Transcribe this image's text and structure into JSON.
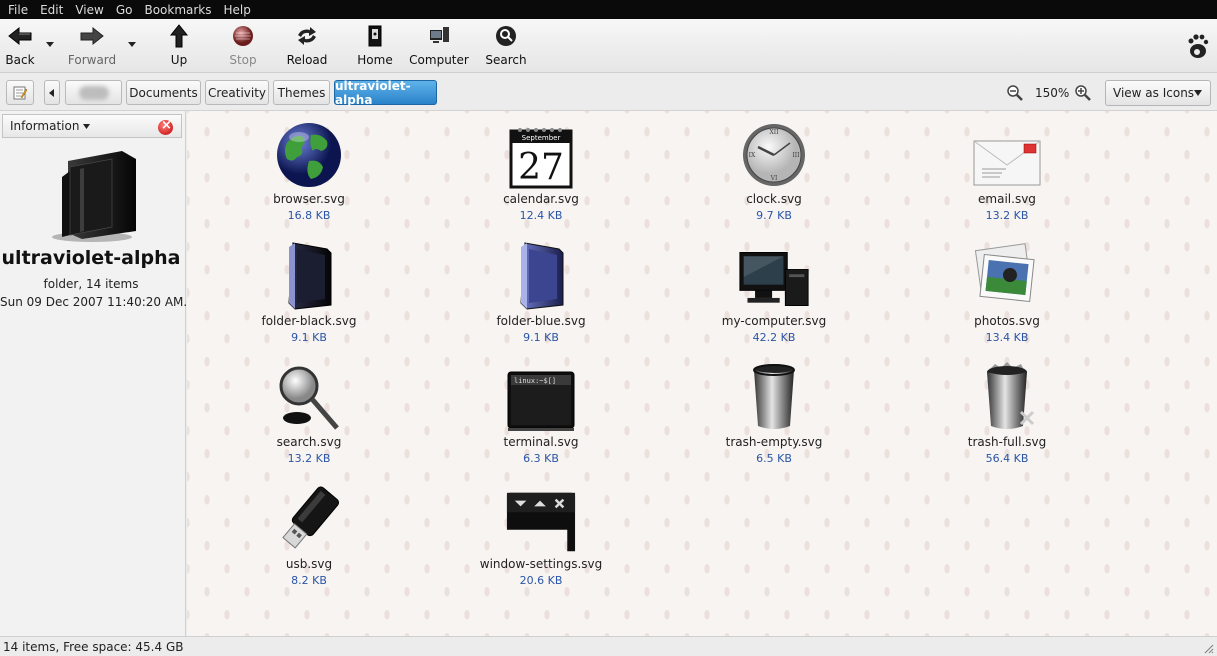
{
  "menubar": {
    "items": [
      "File",
      "Edit",
      "View",
      "Go",
      "Bookmarks",
      "Help"
    ]
  },
  "toolbar": {
    "back": "Back",
    "forward": "Forward",
    "up": "Up",
    "stop": "Stop",
    "reload": "Reload",
    "home": "Home",
    "computer": "Computer",
    "search": "Search"
  },
  "location": {
    "crumbs": [
      "Documents",
      "Creativity",
      "Themes",
      "ultraviolet-alpha"
    ],
    "zoom": "150%",
    "view_mode": "View as Icons"
  },
  "sidebar": {
    "header": "Information",
    "folder_name": "ultraviolet-alpha",
    "folder_info": "folder, 14 items",
    "modified": "Sun 09 Dec 2007 11:40:20 AM..."
  },
  "files": [
    {
      "name": "browser.svg",
      "size": "16.8 KB",
      "icon": "globe-icon"
    },
    {
      "name": "calendar.svg",
      "size": "12.4 KB",
      "icon": "calendar-icon"
    },
    {
      "name": "clock.svg",
      "size": "9.7 KB",
      "icon": "clock-icon"
    },
    {
      "name": "email.svg",
      "size": "13.2 KB",
      "icon": "envelope-icon"
    },
    {
      "name": "folder-black.svg",
      "size": "9.1 KB",
      "icon": "black-folder-icon"
    },
    {
      "name": "folder-blue.svg",
      "size": "9.1 KB",
      "icon": "blue-folder-icon"
    },
    {
      "name": "my-computer.svg",
      "size": "42.2 KB",
      "icon": "computer-icon"
    },
    {
      "name": "photos.svg",
      "size": "13.4 KB",
      "icon": "photos-icon"
    },
    {
      "name": "search.svg",
      "size": "13.2 KB",
      "icon": "magnifier-icon"
    },
    {
      "name": "terminal.svg",
      "size": "6.3 KB",
      "icon": "terminal-icon"
    },
    {
      "name": "trash-empty.svg",
      "size": "6.5 KB",
      "icon": "trash-empty-icon"
    },
    {
      "name": "trash-full.svg",
      "size": "56.4 KB",
      "icon": "trash-full-icon"
    },
    {
      "name": "usb.svg",
      "size": "8.2 KB",
      "icon": "usb-icon"
    },
    {
      "name": "window-settings.svg",
      "size": "20.6 KB",
      "icon": "window-settings-icon"
    }
  ],
  "icon_text": {
    "calendar_month": "September",
    "calendar_day": "27",
    "terminal_prompt": "linux:~$[]"
  },
  "status": {
    "text": "14 items, Free space: 45.4 GB"
  },
  "colors": {
    "accent": "#2a82c9",
    "size_text": "#2a55a8",
    "menubar": "#0a0a0a"
  }
}
